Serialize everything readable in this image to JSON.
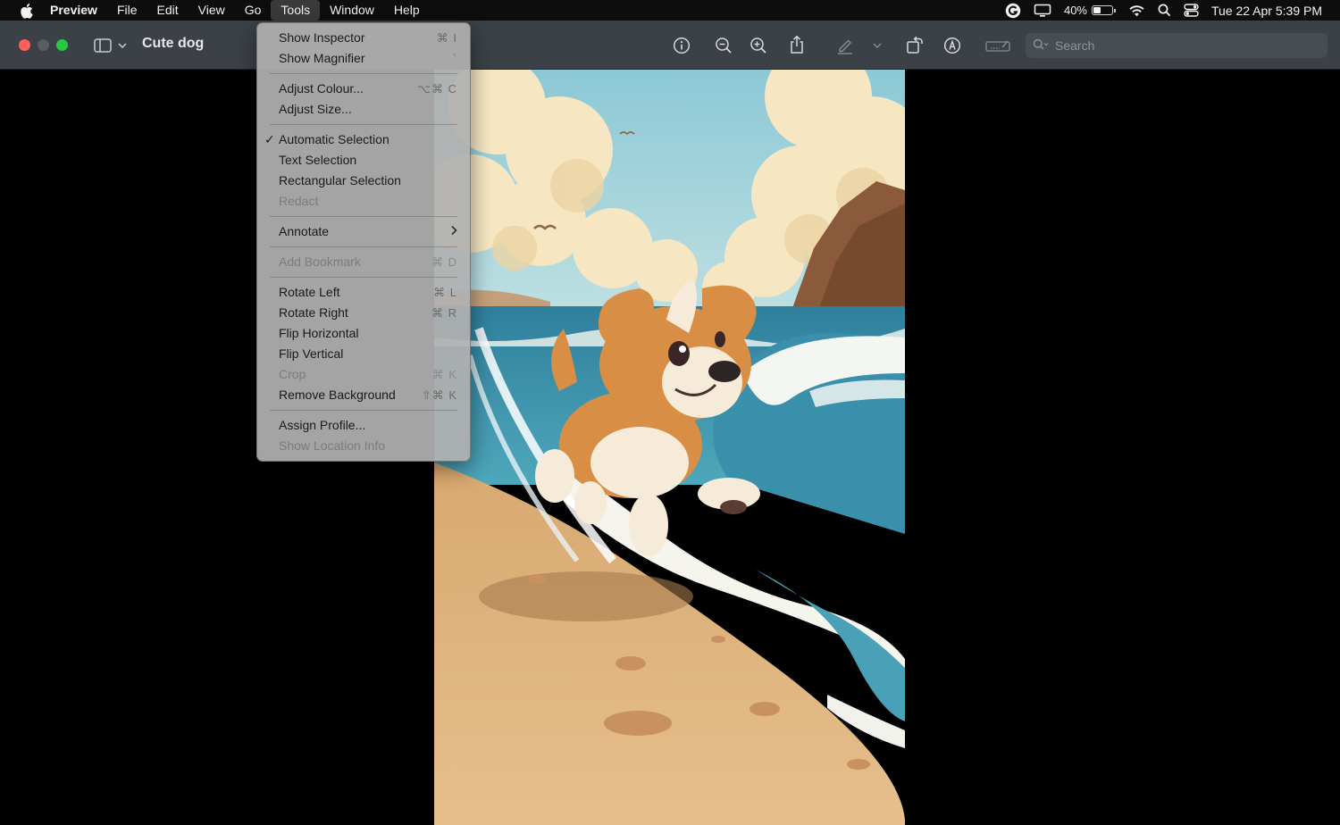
{
  "menubar": {
    "app_name": "Preview",
    "menus": [
      "File",
      "Edit",
      "View",
      "Go",
      "Tools",
      "Window",
      "Help"
    ],
    "active_menu": "Tools",
    "status": {
      "battery_percent": "40%",
      "battery_level": 0.4,
      "clock": "Tue 22 Apr  5:39 PM"
    }
  },
  "window": {
    "title": "Cute dog",
    "search_placeholder": "Search",
    "traffic_colors": [
      "#fe5f57",
      "#5a5d61",
      "#28c840"
    ]
  },
  "tools_menu": {
    "items": [
      {
        "label": "Show Inspector",
        "shortcut": "⌘ I",
        "enabled": true,
        "checked": false
      },
      {
        "label": "Show Magnifier",
        "shortcut": "`",
        "enabled": true,
        "checked": false
      },
      {
        "label": "Adjust Colour...",
        "shortcut": "⌥⌘ C",
        "enabled": true,
        "checked": false
      },
      {
        "label": "Adjust Size...",
        "shortcut": "",
        "enabled": true,
        "checked": false
      },
      {
        "label": "Automatic Selection",
        "shortcut": "",
        "enabled": true,
        "checked": true
      },
      {
        "label": "Text Selection",
        "shortcut": "",
        "enabled": true,
        "checked": false
      },
      {
        "label": "Rectangular Selection",
        "shortcut": "",
        "enabled": true,
        "checked": false
      },
      {
        "label": "Redact",
        "shortcut": "",
        "enabled": false,
        "checked": false
      },
      {
        "label": "Annotate",
        "shortcut": "",
        "enabled": true,
        "checked": false,
        "submenu": true
      },
      {
        "label": "Add Bookmark",
        "shortcut": "⌘ D",
        "enabled": false,
        "checked": false
      },
      {
        "label": "Rotate Left",
        "shortcut": "⌘ L",
        "enabled": true,
        "checked": false
      },
      {
        "label": "Rotate Right",
        "shortcut": "⌘ R",
        "enabled": true,
        "checked": false
      },
      {
        "label": "Flip Horizontal",
        "shortcut": "",
        "enabled": true,
        "checked": false
      },
      {
        "label": "Flip Vertical",
        "shortcut": "",
        "enabled": true,
        "checked": false
      },
      {
        "label": "Crop",
        "shortcut": "⌘ K",
        "enabled": false,
        "checked": false
      },
      {
        "label": "Remove Background",
        "shortcut": "⇧⌘ K",
        "enabled": true,
        "checked": false
      },
      {
        "label": "Assign Profile...",
        "shortcut": "",
        "enabled": true,
        "checked": false
      },
      {
        "label": "Show Location Info",
        "shortcut": "",
        "enabled": false,
        "checked": false
      }
    ]
  }
}
